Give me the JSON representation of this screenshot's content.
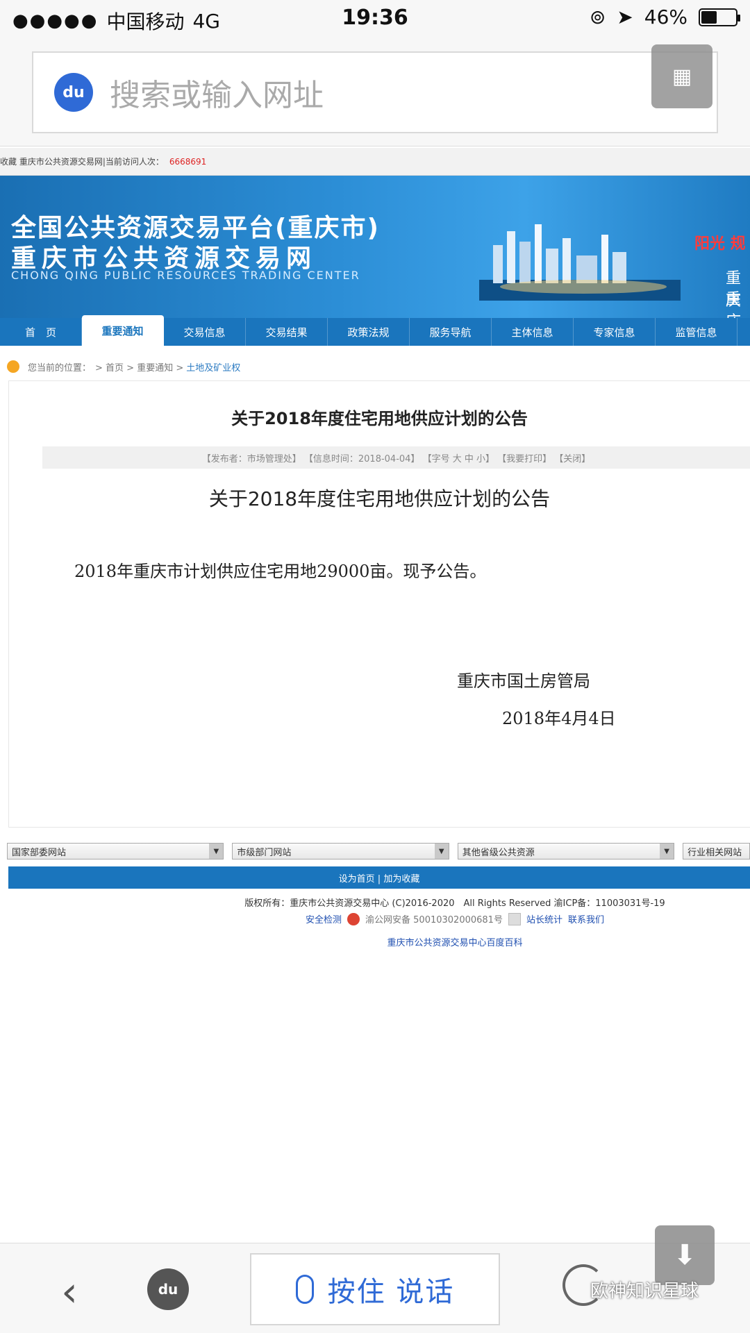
{
  "status_bar": {
    "signal": "●●●●●",
    "carrier": "中国移动",
    "network": "4G",
    "time": "19:36",
    "battery_percent_text": "46%",
    "battery_level": 0.46
  },
  "address_bar": {
    "logo_text": "du",
    "placeholder": "搜索或输入网址"
  },
  "top_strip": {
    "text": "收藏 重庆市公共资源交易网|当前访问人次：",
    "visit_count": "6668691"
  },
  "banner": {
    "title_line1": "全国公共资源交易平台(重庆市)",
    "title_line2": "重庆市公共资源交易网",
    "english": "CHONG QING PUBLIC RESOURCES TRADING CENTER",
    "right_red": "阳光 规",
    "right_white1": "重庆",
    "right_white2": "重庆"
  },
  "nav": {
    "items": [
      {
        "label": "首　页"
      },
      {
        "label": "重要通知"
      },
      {
        "label": "交易信息"
      },
      {
        "label": "交易结果"
      },
      {
        "label": "政策法规"
      },
      {
        "label": "服务导航"
      },
      {
        "label": "主体信息"
      },
      {
        "label": "专家信息"
      },
      {
        "label": "监管信息"
      }
    ]
  },
  "breadcrumb": {
    "prefix": "您当前的位置：",
    "path": "> 首页 > 重要通知 >",
    "current": "土地及矿业权"
  },
  "article": {
    "title": "关于2018年度住宅用地供应计划的公告",
    "meta": "【发布者：市场管理处】 【信息时间：2018-04-04】 【字号 大 中 小】 【我要打印】 【关闭】",
    "title2": "关于2018年度住宅用地供应计划的公告",
    "body": "2018年重庆市计划供应住宅用地29000亩。现予公告。",
    "signature": "重庆市国土房管局",
    "date": "2018年4月4日"
  },
  "dropdowns": [
    {
      "label": "国家部委网站"
    },
    {
      "label": "市级部门网站"
    },
    {
      "label": "其他省级公共资源"
    },
    {
      "label": "行业相关网站"
    }
  ],
  "footer": {
    "bar_text": "设为首页 | 加为收藏",
    "copyright": "版权所有：重庆市公共资源交易中心 (C)2016-2020　All Rights Reserved 渝ICP备：11003031号-19",
    "security": "安全检测",
    "police": "渝公网安备 50010302000681号",
    "stats": "站长统计",
    "contact": "联系我们",
    "baike": "重庆市公共资源交易中心百度百科"
  },
  "bottom_bar": {
    "back_glyph": "‹",
    "paw_text": "du",
    "voice_label": "按住 说话",
    "download_glyph": "⬇",
    "watermark": "欧神知识星球"
  }
}
